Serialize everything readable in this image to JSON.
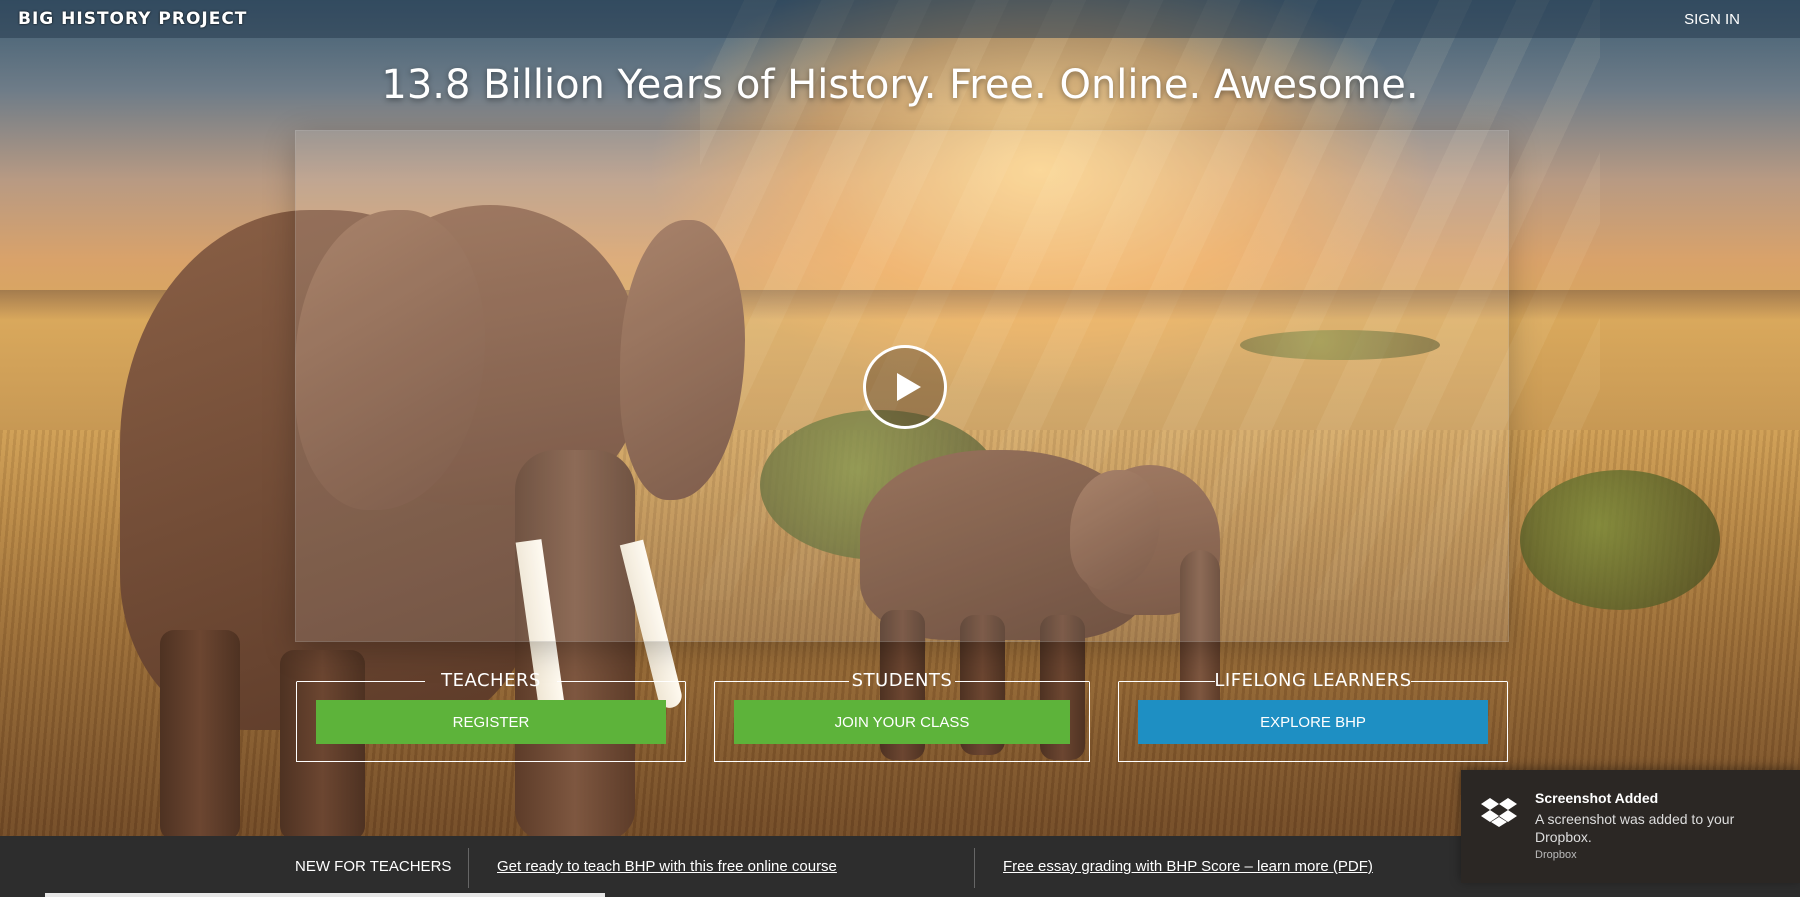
{
  "header": {
    "brand": "BIG HISTORY PROJECT",
    "sign_in": "SIGN IN"
  },
  "hero": {
    "headline": "13.8 Billion Years of History. Free. Online. Awesome.",
    "play_icon": "play-icon"
  },
  "audiences": [
    {
      "title": "TEACHERS",
      "button": "REGISTER",
      "color": "#5db33a"
    },
    {
      "title": "STUDENTS",
      "button": "JOIN YOUR CLASS",
      "color": "#5db33a"
    },
    {
      "title": "LIFELONG LEARNERS",
      "button": "EXPLORE BHP",
      "color": "#1e8fc3"
    }
  ],
  "footer_bar": {
    "label": "NEW FOR TEACHERS",
    "link1": "Get ready to teach BHP with this free online course",
    "link2": "Free essay grading with BHP Score – learn more (PDF)"
  },
  "toast": {
    "title": "Screenshot Added",
    "message": "A screenshot was added to your Dropbox.",
    "source": "Dropbox",
    "icon": "dropbox-icon"
  }
}
